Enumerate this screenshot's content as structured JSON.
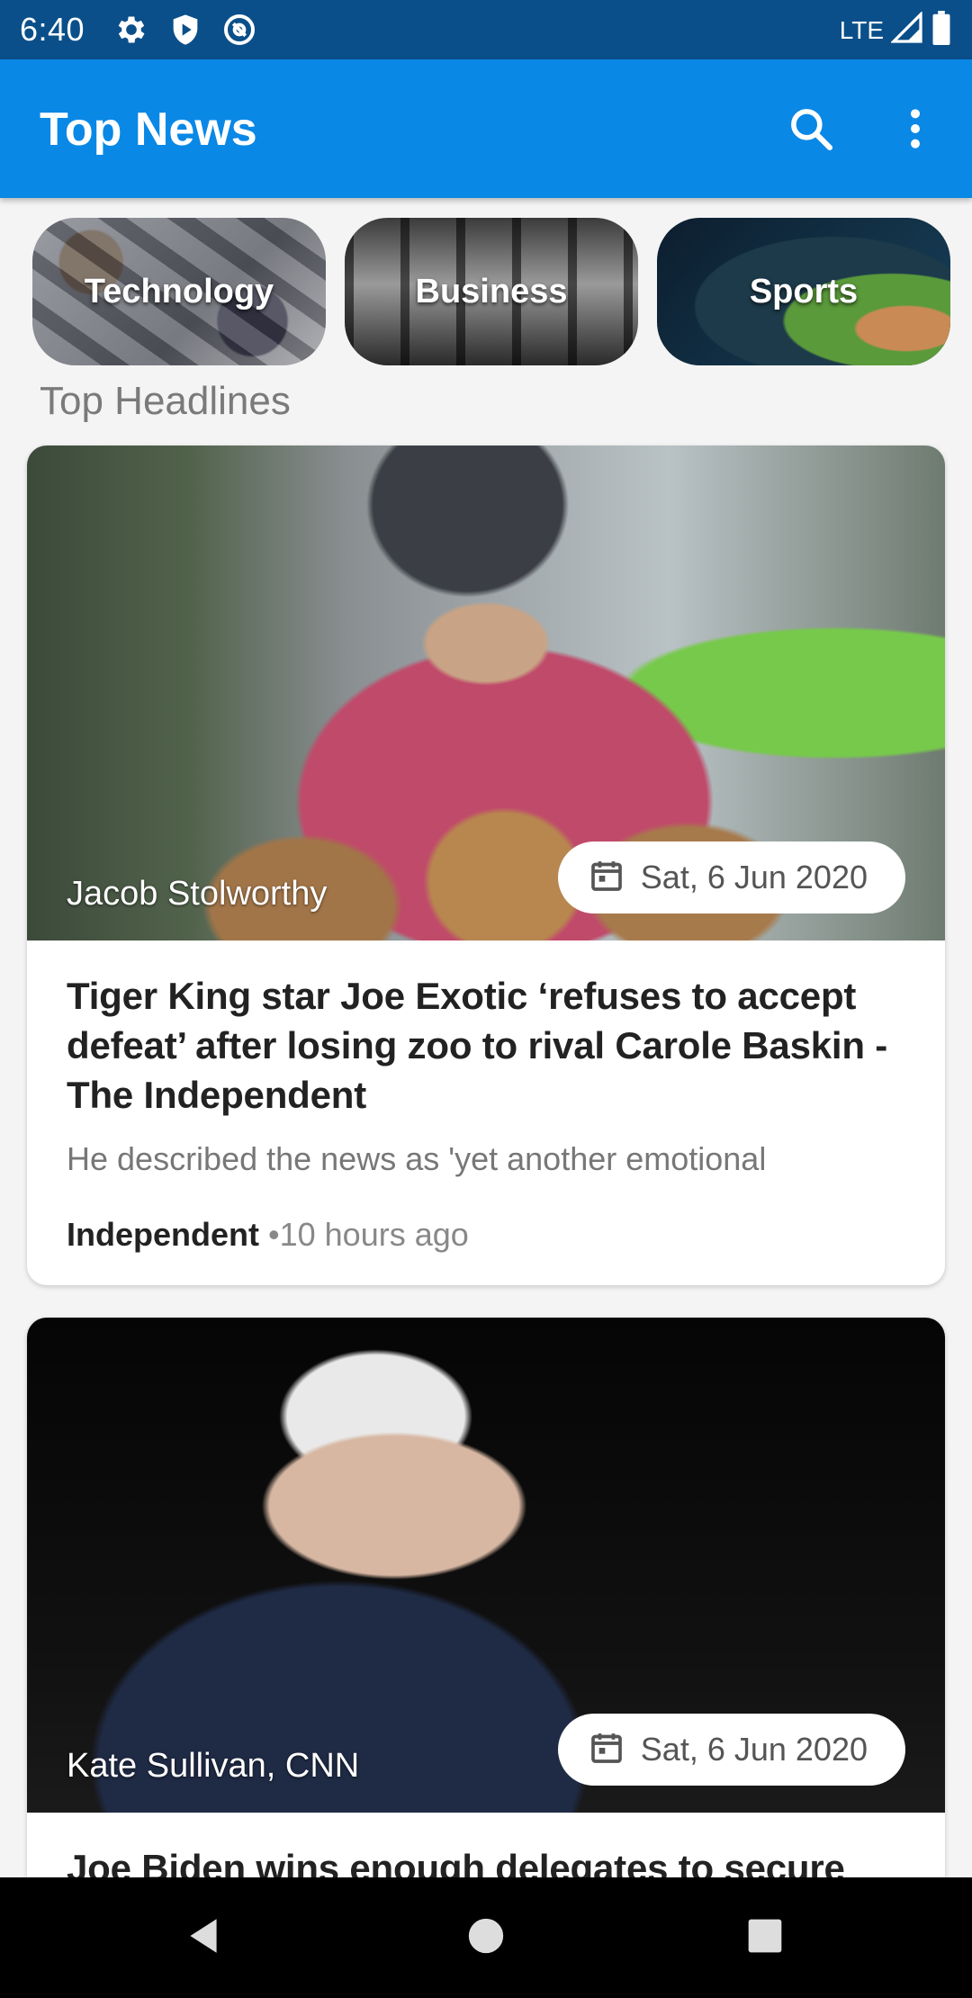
{
  "status_bar": {
    "time": "6:40",
    "network": "LTE",
    "icons": [
      "gear-icon",
      "shield-icon",
      "at-sign-icon",
      "signal-icon",
      "battery-icon"
    ]
  },
  "app_bar": {
    "title": "Top News",
    "actions": [
      "search-icon",
      "more-vert-icon"
    ]
  },
  "categories": [
    {
      "label": "Technology"
    },
    {
      "label": "Business"
    },
    {
      "label": "Sports"
    }
  ],
  "section_title": "Top Headlines",
  "articles": [
    {
      "author": "Jacob Stolworthy",
      "date": "Sat, 6 Jun 2020",
      "headline": "Tiger King star Joe Exotic ‘refuses to accept defeat’ after losing zoo to rival Carole Baskin - The Independent",
      "description": "He described the news as 'yet another emotional",
      "source": "Independent",
      "time_ago": "•10 hours ago"
    },
    {
      "author": "Kate Sullivan, CNN",
      "date": "Sat, 6 Jun 2020",
      "headline": "Joe Biden wins enough delegates to secure"
    }
  ],
  "colors": {
    "status_bar": "#0a4f8a",
    "app_bar": "#0a88e6",
    "background": "#f4f4f4",
    "nav_bar": "#000000"
  }
}
